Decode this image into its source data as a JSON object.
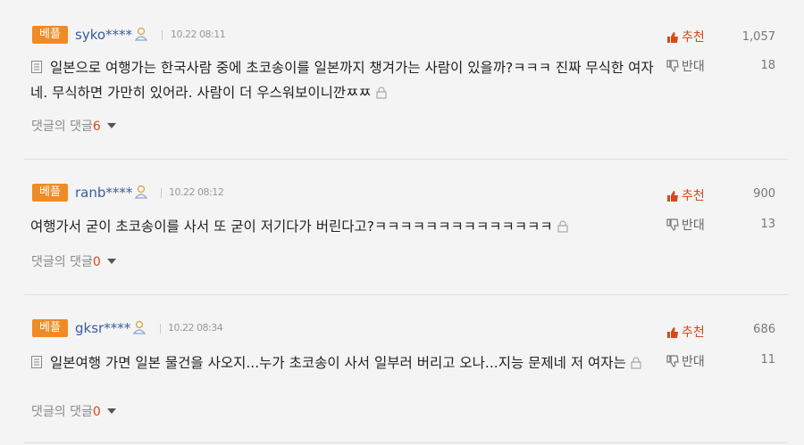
{
  "comments": [
    {
      "badge": "베플",
      "user": "syko****",
      "date": "10.22 08:11",
      "text": "일본으로 여행가는 한국사람 중에 초코송이를 일본까지 챙겨가는 사람이 있을까?ㅋㅋㅋ 진짜 무식한 여자네. 무식하면 가만히 있어라. 사람이 더 우스워보이니깐ㅉㅉ",
      "reply_label": "댓글의 댓글",
      "reply_count": "6",
      "recommend_label": "추천",
      "recommend_count": "1,057",
      "oppose_label": "반대",
      "oppose_count": "18"
    },
    {
      "badge": "베플",
      "user": "ranb****",
      "date": "10.22 08:12",
      "text": "여행가서 굳이 초코송이를 사서 또 굳이 저기다가 버린다고?ㅋㅋㅋㅋㅋㅋㅋㅋㅋㅋㅋㅋㅋㅋ",
      "reply_label": "댓글의 댓글",
      "reply_count": "0",
      "recommend_label": "추천",
      "recommend_count": "900",
      "oppose_label": "반대",
      "oppose_count": "13"
    },
    {
      "badge": "베플",
      "user": "gksr****",
      "date": "10.22 08:34",
      "text": "일본여행 가면 일본 물건을 사오지...누가 초코송이 사서 일부러 버리고 오나...지능 문제네 저 여자는",
      "reply_label": "댓글의 댓글",
      "reply_count": "0",
      "recommend_label": "추천",
      "recommend_count": "686",
      "oppose_label": "반대",
      "oppose_count": "11"
    }
  ],
  "colors": {
    "badge": "#f08a24",
    "user": "#3a5aa3",
    "accent": "#d64a1a",
    "background": "#f4f4f4"
  },
  "icons": {
    "user": "user-icon",
    "memo": "memo-icon",
    "lock": "lock-icon",
    "recommend": "thumbs-up-icon",
    "oppose": "thumbs-down-icon",
    "caret": "chevron-down-icon"
  }
}
